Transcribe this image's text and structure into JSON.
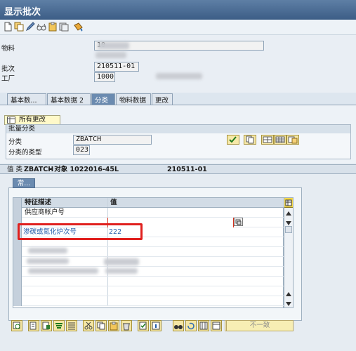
{
  "window": {
    "title": "显示批次"
  },
  "toolbar": {
    "icons": [
      "new-icon",
      "copy-icon",
      "edit-icon",
      "glasses-icon",
      "clipboard-icon",
      "copy-document-icon",
      "bucket-icon"
    ]
  },
  "header": {
    "material_label": "物料",
    "material_value": "10",
    "batch_label": "批次",
    "batch_value": "210511-01",
    "plant_label": "工厂",
    "plant_value": "1000"
  },
  "tabs": [
    {
      "label": "基本数..."
    },
    {
      "label": "基本数据 2"
    },
    {
      "label": "分类",
      "active": true
    },
    {
      "label": "物料数据"
    },
    {
      "label": "更改"
    }
  ],
  "classification": {
    "all_changes_label": "所有更改",
    "group_title": "批量分类",
    "class_label": "分类",
    "class_value": "ZBATCH",
    "class_type_label": "分类的类型",
    "class_type_value": "023"
  },
  "values_header": {
    "prefix": "值 类",
    "class_name": "ZBATCH",
    "object_text": "- 对象 1022016-45L",
    "batch": "210511-01"
  },
  "subtab": {
    "label": "常..."
  },
  "grid": {
    "headers": {
      "characteristic": "特征描述",
      "value": "值"
    },
    "rows": [
      {
        "characteristic": "供应商帐户号",
        "value": ""
      },
      {
        "characteristic": "",
        "value": ""
      },
      {
        "characteristic": "渗碳或氮化炉次号",
        "value": "222"
      },
      {
        "characteristic": "",
        "value": ""
      },
      {
        "characteristic": "",
        "value": ""
      },
      {
        "characteristic": "",
        "value": ""
      },
      {
        "characteristic": "",
        "value": ""
      },
      {
        "characteristic": "",
        "value": ""
      },
      {
        "characteristic": "",
        "value": ""
      },
      {
        "characteristic": "",
        "value": ""
      }
    ]
  },
  "footer": {
    "inconsistent_label": "不一致"
  },
  "colors": {
    "title_bg": "#3c5d86",
    "active_tab": "#6b8bb0",
    "highlight": "#e0201e"
  }
}
